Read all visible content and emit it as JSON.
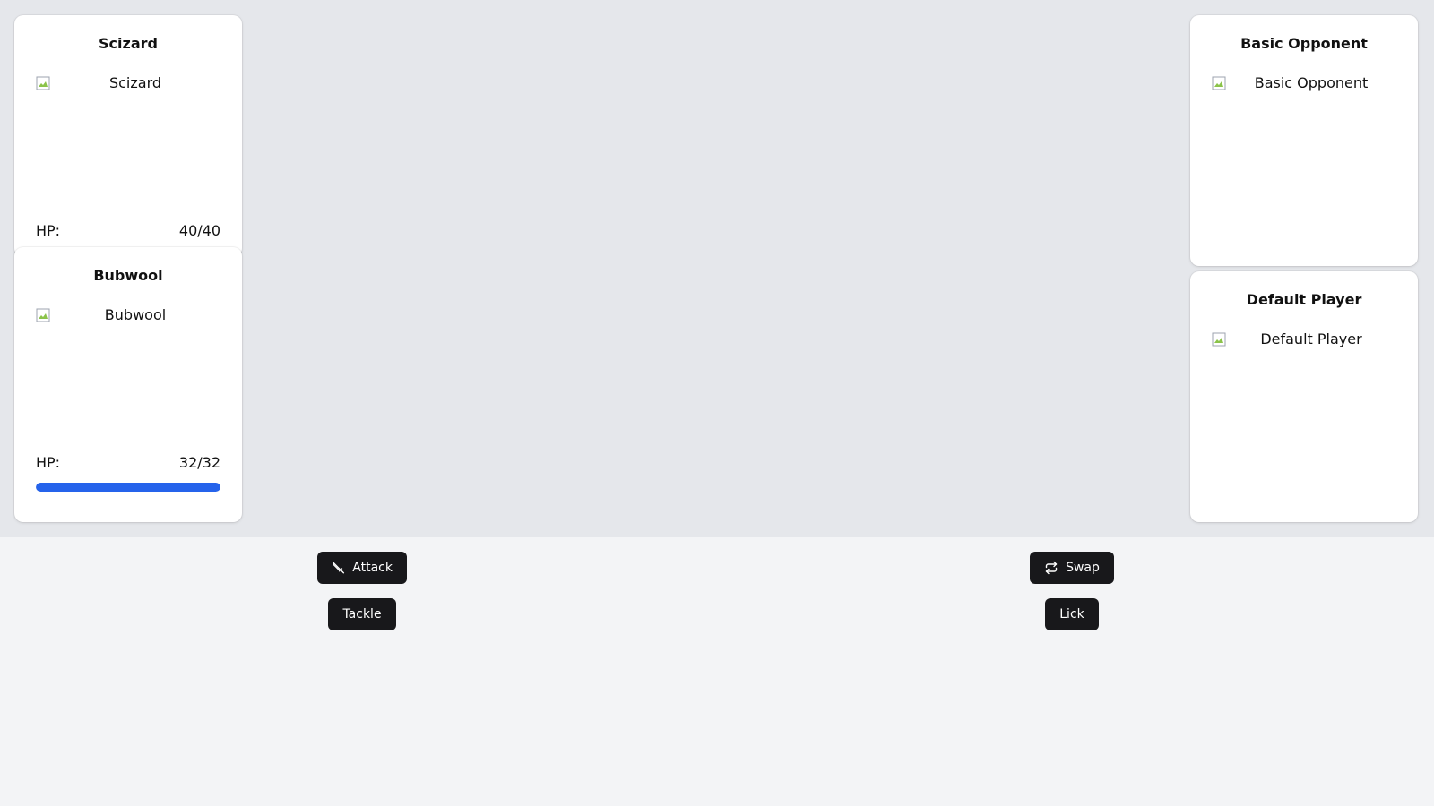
{
  "player_side": {
    "back_card": {
      "name": "Scizard",
      "sprite_alt": "Scizard",
      "hp_label": "HP:",
      "hp_value": "40/40"
    },
    "front_card": {
      "name": "Bubwool",
      "sprite_alt": "Bubwool",
      "hp_label": "HP:",
      "hp_value": "32/32",
      "hp_fraction": 1.0
    }
  },
  "opponent_side": {
    "top_card": {
      "name": "Basic Opponent",
      "sprite_alt": "Basic Opponent"
    },
    "bottom_card": {
      "name": "Default Player",
      "sprite_alt": "Default Player"
    }
  },
  "actions": {
    "attack_label": "Attack",
    "attack_icon": "sword-icon",
    "swap_label": "Swap",
    "swap_icon": "swap-arrows-icon",
    "move_1_label": "Tackle",
    "move_2_label": "Lick"
  },
  "colors": {
    "hp_bar": "#2563eb",
    "button_bg": "#18181b",
    "arena_bg": "#e5e7eb",
    "page_bg": "#f3f4f6"
  }
}
